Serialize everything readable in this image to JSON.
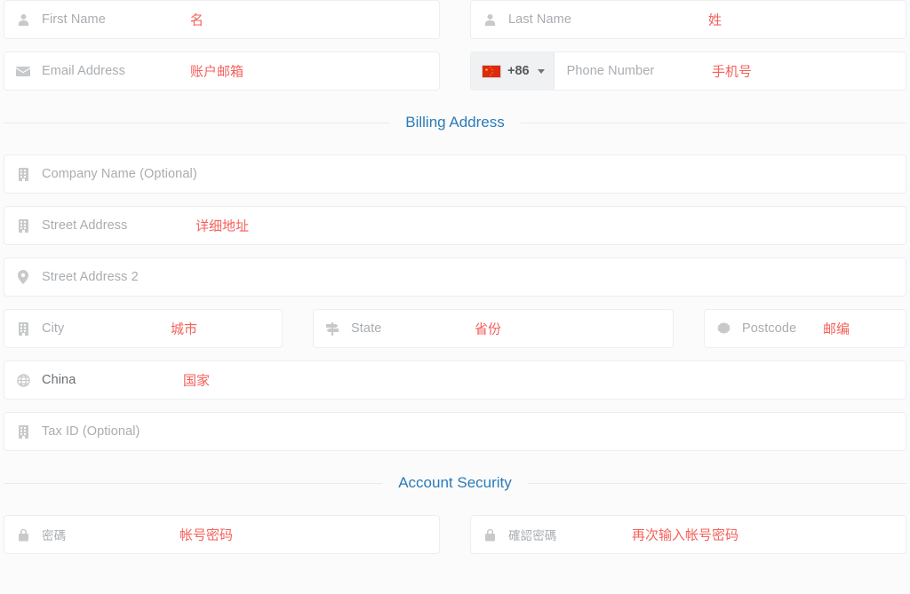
{
  "sections": {
    "billing": {
      "title": "Billing Address"
    },
    "security": {
      "title": "Account Security"
    }
  },
  "fields": {
    "first_name": {
      "placeholder": "First Name",
      "icon": "user-icon",
      "annotation": "名"
    },
    "last_name": {
      "placeholder": "Last Name",
      "icon": "user-icon",
      "annotation": "姓"
    },
    "email": {
      "placeholder": "Email Address",
      "icon": "envelope-icon",
      "annotation": "账户邮箱"
    },
    "phone": {
      "placeholder": "Phone Number",
      "dial_code": "+86",
      "flag": "china-flag-icon",
      "annotation": "手机号"
    },
    "company": {
      "placeholder": "Company Name (Optional)",
      "icon": "building-icon",
      "annotation": ""
    },
    "street": {
      "placeholder": "Street Address",
      "icon": "building-icon",
      "annotation": "详细地址"
    },
    "street2": {
      "placeholder": "Street Address 2",
      "icon": "map-pin-icon",
      "annotation": ""
    },
    "city": {
      "placeholder": "City",
      "icon": "building-icon",
      "annotation": "城市"
    },
    "state": {
      "placeholder": "State",
      "icon": "map-signs-icon",
      "annotation": "省份"
    },
    "postcode": {
      "placeholder": "Postcode",
      "icon": "certificate-icon",
      "annotation": "邮编"
    },
    "country": {
      "value": "China",
      "icon": "globe-icon",
      "annotation": "国家"
    },
    "tax_id": {
      "placeholder": "Tax ID (Optional)",
      "icon": "building-icon",
      "annotation": ""
    },
    "password": {
      "placeholder": "密碼",
      "icon": "lock-icon",
      "annotation": "帐号密码"
    },
    "confirm_password": {
      "placeholder": "確認密碼",
      "icon": "lock-icon",
      "annotation": "再次输入帐号密码"
    }
  },
  "colors": {
    "annotation_red": "#f4605a",
    "section_blue": "#2b7bb9",
    "placeholder_gray": "#a9adb1",
    "field_border": "#eceef0",
    "flag_red": "#de2910",
    "flag_yellow": "#ffde00"
  }
}
